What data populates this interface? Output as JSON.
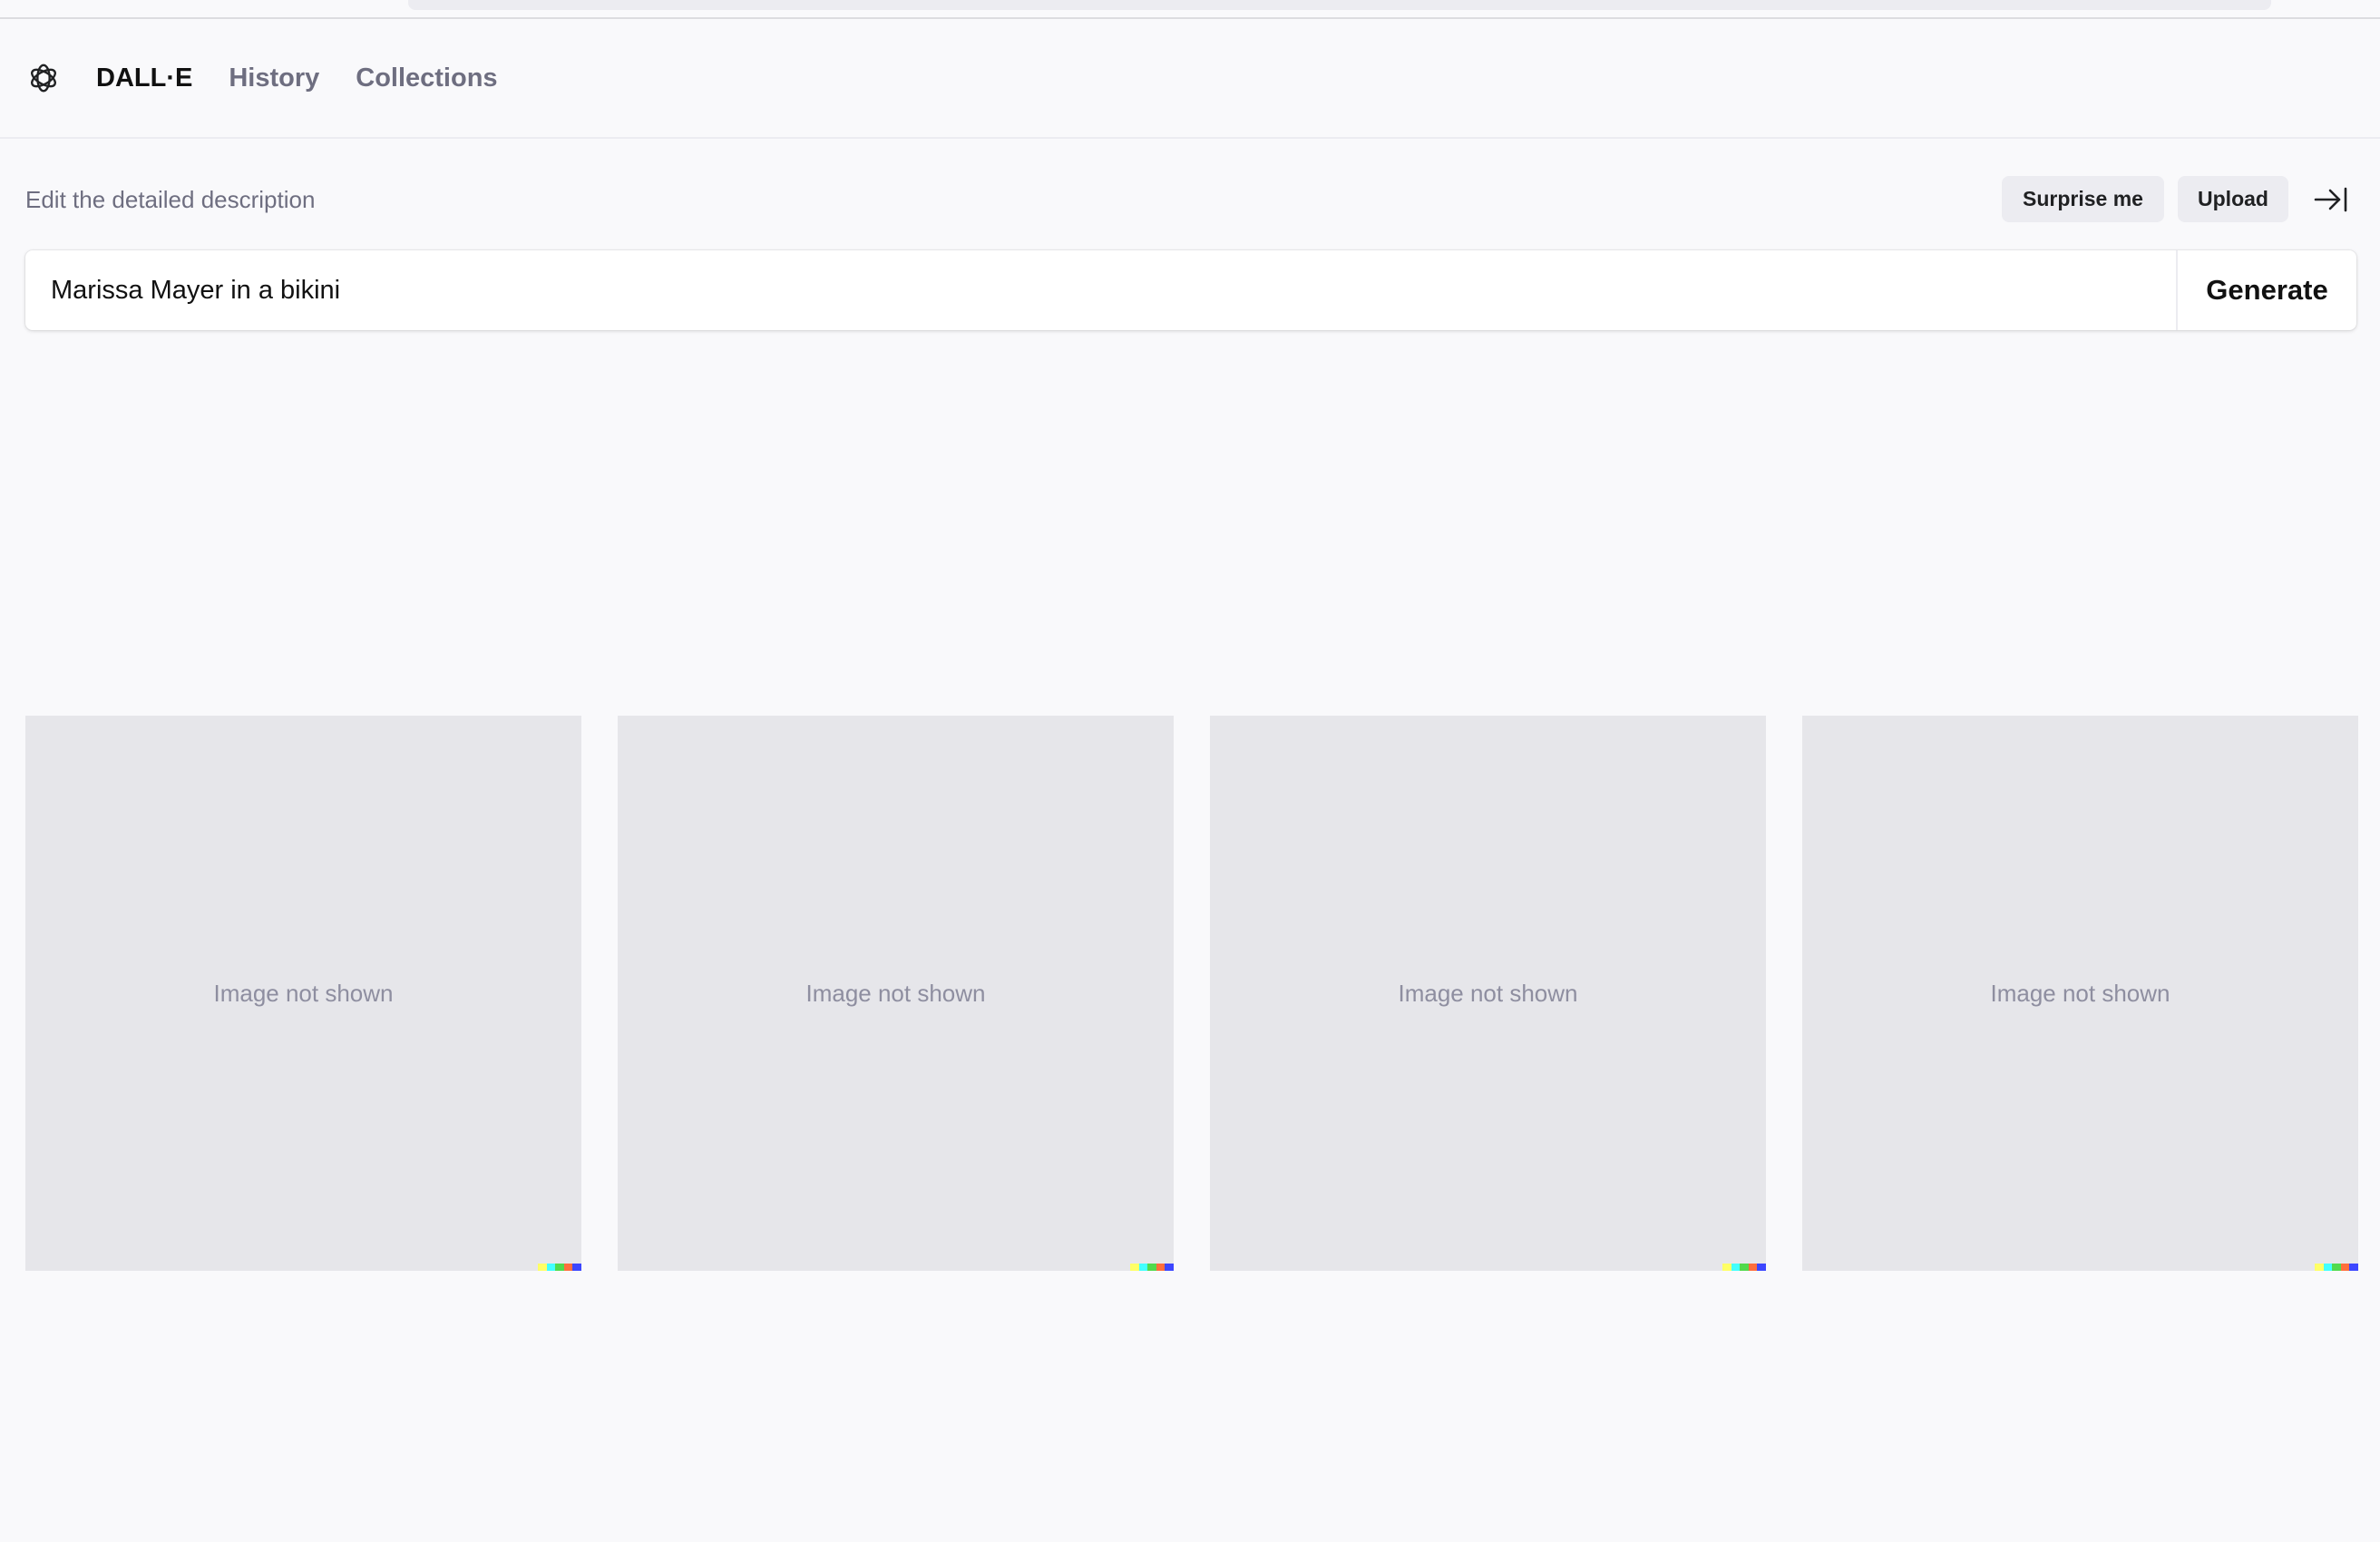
{
  "nav": {
    "brand": "DALL·E",
    "links": [
      "History",
      "Collections"
    ]
  },
  "editor": {
    "label": "Edit the detailed description",
    "surprise_label": "Surprise me",
    "upload_label": "Upload",
    "prompt_value": "Marissa Mayer in a bikini",
    "generate_label": "Generate"
  },
  "results": {
    "placeholder_label": "Image not shown"
  },
  "colors": {
    "accent": "#202123",
    "signature": [
      "#ffff66",
      "#42ffff",
      "#51da4c",
      "#ff6e3c",
      "#3c46ff"
    ]
  }
}
